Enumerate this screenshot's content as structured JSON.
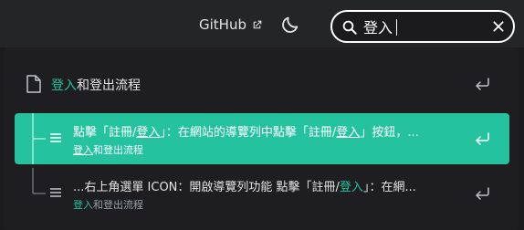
{
  "navbar": {
    "github_label": "GitHub",
    "icons": [
      "external-link-icon",
      "moon-icon"
    ]
  },
  "search": {
    "value": "登入",
    "icons": [
      "search-icon",
      "clear-icon"
    ]
  },
  "results": {
    "page_hit": {
      "icon": "page-icon",
      "title_match": "登入",
      "title_rest": "和登出流程"
    },
    "hits": [
      {
        "title_pre": "點擊「註冊/",
        "title_match1": "登入",
        "title_mid": "」：在網站的導覽列中點擊「註冊/",
        "title_match2": "登入",
        "title_post": "」按鈕，...",
        "path_match": "登入",
        "path_rest": "和登出流程",
        "active": true
      },
      {
        "title_pre": "...右上角選單 ICON：開啟導覽列功能 點擊「註冊/",
        "title_match1": "登入",
        "title_post": "」：在網...",
        "path_match": "登入",
        "path_rest": "和登出流程",
        "active": false
      }
    ]
  },
  "colors": {
    "accent": "#25c2a0",
    "background": "#1b1b1d"
  }
}
